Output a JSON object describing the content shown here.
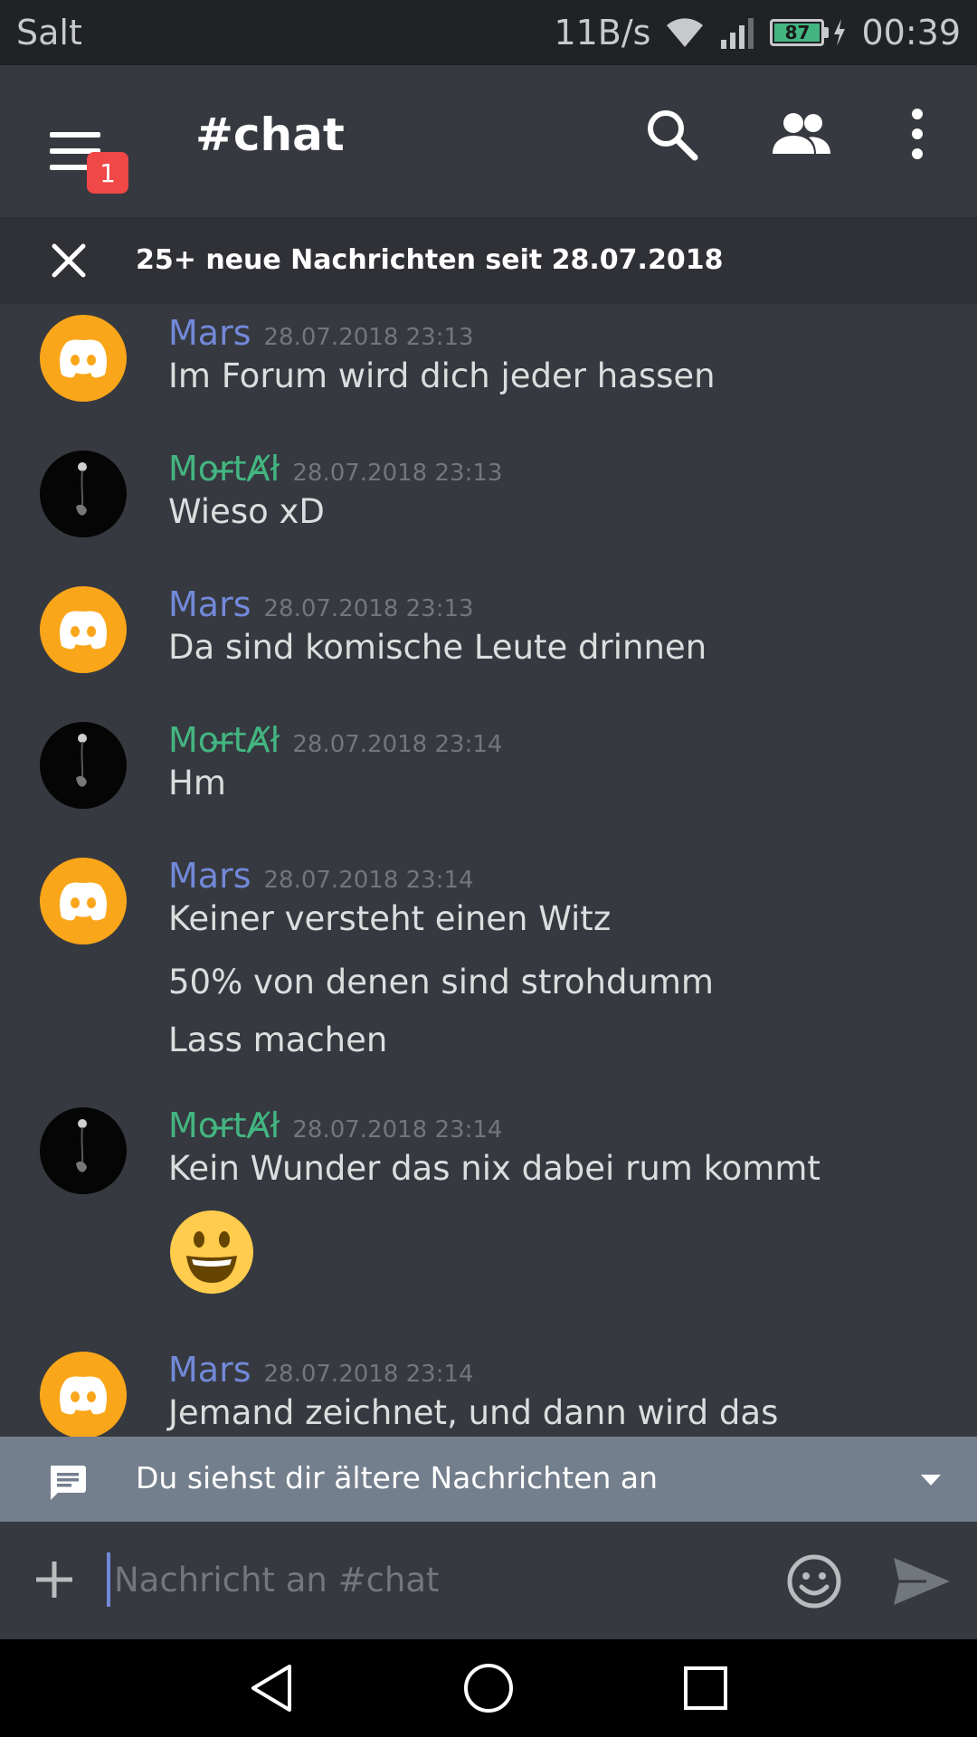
{
  "status_bar": {
    "carrier": "Salt",
    "net_speed": "11B/s",
    "battery": "87",
    "time": "00:39"
  },
  "app_bar": {
    "channel": "#chat",
    "notification_badge": "1",
    "icons": [
      "menu-icon",
      "search-icon",
      "members-icon",
      "more-vert-icon"
    ]
  },
  "new_messages_banner": {
    "text": "25+ neue Nachrichten seit 28.07.2018"
  },
  "messages": [
    {
      "author": "Mars",
      "time": "28.07.2018 23:13",
      "lines": [
        "Im Forum wird dich jeder hassen"
      ]
    },
    {
      "author": "Mor̶tȺł",
      "time": "28.07.2018 23:13",
      "lines": [
        "Wieso xD"
      ]
    },
    {
      "author": "Mars",
      "time": "28.07.2018 23:13",
      "lines": [
        "Da sind komische Leute drinnen"
      ]
    },
    {
      "author": "Mor̶tȺł",
      "time": "28.07.2018 23:14",
      "lines": [
        "Hm"
      ]
    },
    {
      "author": "Mars",
      "time": "28.07.2018 23:14",
      "lines": [
        "Keiner versteht einen Witz",
        "50% von denen sind strohdumm",
        "Lass machen"
      ]
    },
    {
      "author": "Mor̶tȺł",
      "time": "28.07.2018 23:14",
      "lines": [
        "Kein Wunder das nix dabei rum kommt"
      ],
      "emoji": "smiley-emoji"
    },
    {
      "author": "Mars",
      "time": "28.07.2018 23:14",
      "lines": [
        "Jemand zeichnet, und dann wird das"
      ]
    }
  ],
  "older_bar": {
    "text": "Du siehst dir ältere Nachrichten an"
  },
  "composer": {
    "placeholder": "Nachricht an #chat"
  },
  "colors": {
    "background": "#36393f",
    "mars_name": "#7289da",
    "mortal_name": "#43b581",
    "mars_avatar": "#faa61a",
    "badge": "#f04747",
    "older_bar": "#747f8d"
  }
}
